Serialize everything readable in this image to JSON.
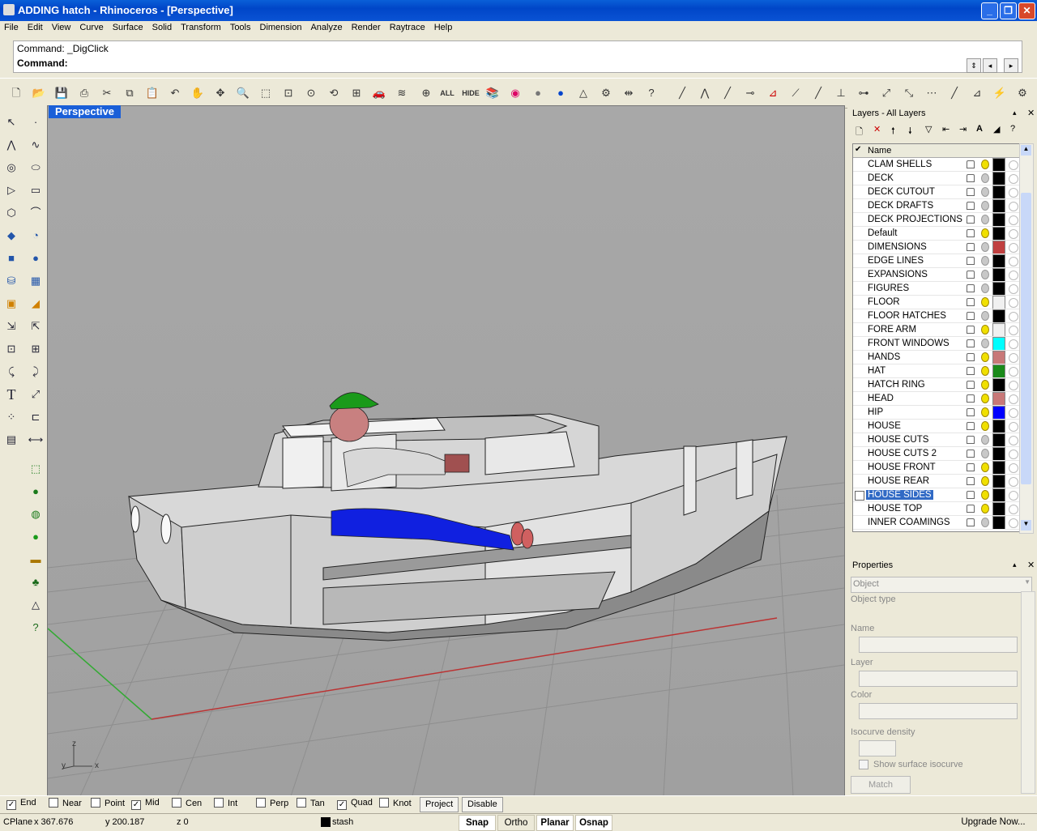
{
  "window": {
    "title": "ADDING hatch  - Rhinoceros - [Perspective]"
  },
  "menu": [
    "File",
    "Edit",
    "View",
    "Curve",
    "Surface",
    "Solid",
    "Transform",
    "Tools",
    "Dimension",
    "Analyze",
    "Render",
    "Raytrace",
    "Help"
  ],
  "command": {
    "history": "Command: _DigClick",
    "prompt": "Command:"
  },
  "toolbar": {
    "all_label": "ALL",
    "hide_label": "HIDE"
  },
  "viewport": {
    "title": "Perspective",
    "axes": {
      "z": "z",
      "y": "y",
      "x": "x"
    }
  },
  "layers": {
    "panel_title": "Layers - All Layers",
    "column_name": "Name",
    "rows": [
      {
        "name": "CLAM SHELLS",
        "on": true,
        "color": "#000000"
      },
      {
        "name": "DECK",
        "on": false,
        "color": "#000000"
      },
      {
        "name": "DECK CUTOUT",
        "on": false,
        "color": "#000000"
      },
      {
        "name": "DECK DRAFTS",
        "on": false,
        "color": "#000000"
      },
      {
        "name": "DECK PROJECTIONS",
        "on": false,
        "color": "#000000"
      },
      {
        "name": "Default",
        "on": true,
        "color": "#000000"
      },
      {
        "name": "DIMENSIONS",
        "on": false,
        "color": "#c04040"
      },
      {
        "name": "EDGE LINES",
        "on": false,
        "color": "#000000"
      },
      {
        "name": "EXPANSIONS",
        "on": false,
        "color": "#000000"
      },
      {
        "name": "FIGURES",
        "on": false,
        "color": "#000000"
      },
      {
        "name": "FLOOR",
        "on": true,
        "color": "#f0f0f0"
      },
      {
        "name": "FLOOR HATCHES",
        "on": false,
        "color": "#000000"
      },
      {
        "name": "FORE ARM",
        "on": true,
        "color": "#f0f0f0"
      },
      {
        "name": "FRONT WINDOWS",
        "on": false,
        "color": "#00ffff"
      },
      {
        "name": "HANDS",
        "on": true,
        "color": "#c87878"
      },
      {
        "name": "HAT",
        "on": true,
        "color": "#1a8a1a"
      },
      {
        "name": "HATCH RING",
        "on": true,
        "color": "#000000"
      },
      {
        "name": "HEAD",
        "on": true,
        "color": "#c87878"
      },
      {
        "name": "HIP",
        "on": true,
        "color": "#0000ff"
      },
      {
        "name": "HOUSE",
        "on": true,
        "color": "#000000"
      },
      {
        "name": "HOUSE CUTS",
        "on": false,
        "color": "#000000"
      },
      {
        "name": "HOUSE CUTS 2",
        "on": false,
        "color": "#000000"
      },
      {
        "name": "HOUSE FRONT",
        "on": true,
        "color": "#000000"
      },
      {
        "name": "HOUSE REAR",
        "on": true,
        "color": "#000000"
      },
      {
        "name": "HOUSE SIDES",
        "on": true,
        "color": "#000000",
        "selected": true
      },
      {
        "name": "HOUSE TOP",
        "on": true,
        "color": "#000000"
      },
      {
        "name": "INNER COAMINGS",
        "on": false,
        "color": "#000000"
      }
    ]
  },
  "properties": {
    "panel_title": "Properties",
    "select_value": "Object",
    "object_type_label": "Object type",
    "name_label": "Name",
    "layer_label": "Layer",
    "color_label": "Color",
    "isocurve_label": "Isocurve density",
    "show_isocurve_label": "Show surface isocurve",
    "match_label": "Match"
  },
  "osnap": {
    "items": [
      {
        "label": "End",
        "checked": true
      },
      {
        "label": "Near",
        "checked": false
      },
      {
        "label": "Point",
        "checked": false
      },
      {
        "label": "Mid",
        "checked": true
      },
      {
        "label": "Cen",
        "checked": false
      },
      {
        "label": "Int",
        "checked": false
      },
      {
        "label": "Perp",
        "checked": false
      },
      {
        "label": "Tan",
        "checked": false
      },
      {
        "label": "Quad",
        "checked": true
      },
      {
        "label": "Knot",
        "checked": false
      }
    ],
    "project_label": "Project",
    "disable_label": "Disable"
  },
  "status": {
    "cplane": "CPlane",
    "x": "x 367.676",
    "y": "y 200.187",
    "z": "z 0",
    "layer": "stash",
    "snap": "Snap",
    "ortho": "Ortho",
    "planar": "Planar",
    "osnap": "Osnap",
    "upgrade": "Upgrade Now..."
  }
}
